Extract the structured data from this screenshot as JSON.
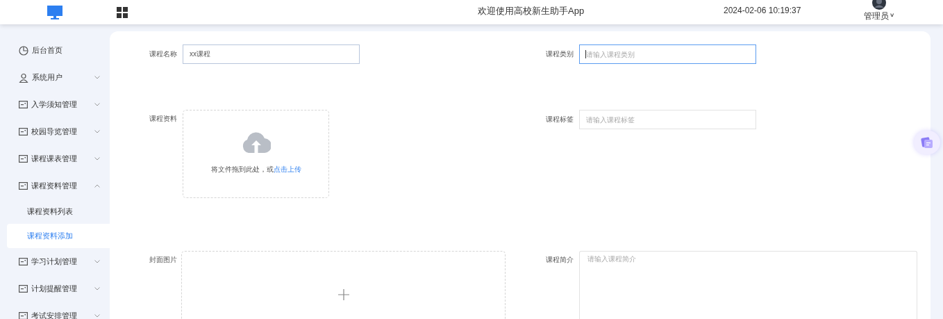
{
  "header": {
    "title": "欢迎使用高校新生助手App",
    "datetime": "2024-02-06 10:19:37",
    "user": "管理员",
    "user_caret": "˅"
  },
  "sidebar": {
    "items": [
      {
        "label": "后台首页"
      },
      {
        "label": "系统用户",
        "expanded": false
      },
      {
        "label": "入学须知管理",
        "expanded": false
      },
      {
        "label": "校园导览管理",
        "expanded": false
      },
      {
        "label": "课程课表管理",
        "expanded": false
      },
      {
        "label": "课程资料管理",
        "expanded": true,
        "children": [
          {
            "label": "课程资料列表",
            "selected": false
          },
          {
            "label": "课程资料添加",
            "selected": true
          }
        ]
      },
      {
        "label": "学习计划管理",
        "expanded": false
      },
      {
        "label": "计划提醒管理",
        "expanded": false
      },
      {
        "label": "考试安排管理",
        "expanded": false
      }
    ]
  },
  "form": {
    "rows": [
      [
        {
          "kind": "input",
          "label": "课程名称",
          "value": "xx课程",
          "focused": false
        },
        {
          "kind": "input",
          "label": "课程类别",
          "placeholder": "请输入课程类别",
          "focused": true
        }
      ],
      [
        {
          "kind": "upload",
          "label": "课程资料",
          "hint": "将文件拖到此处，或",
          "link": "点击上传"
        },
        {
          "kind": "input",
          "label": "课程标签",
          "placeholder": "请输入课程标签",
          "focused": false
        }
      ],
      [
        {
          "kind": "image",
          "label": "封面图片"
        },
        {
          "kind": "textarea",
          "label": "课程简介",
          "placeholder": "请输入课程简介"
        }
      ]
    ]
  }
}
